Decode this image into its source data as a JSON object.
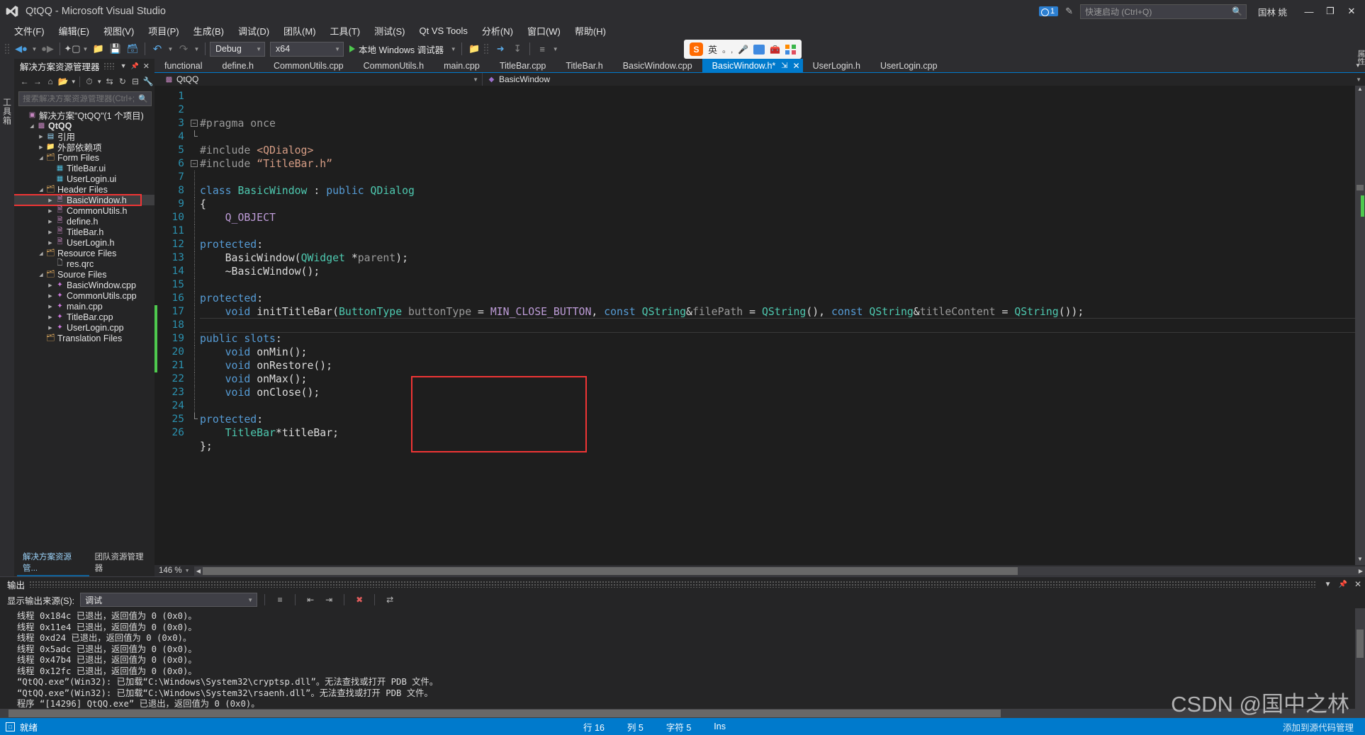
{
  "window": {
    "title": "QtQQ - Microsoft Visual Studio",
    "logo_icon": "visual-studio-logo",
    "minimize_label": "—",
    "maximize_label": "❐",
    "close_label": "✕",
    "notification_count": "1",
    "feedback_icon": "feedback-icon",
    "user_name": "国林 姚",
    "quick_launch_placeholder": "快速启动 (Ctrl+Q)",
    "quick_launch_value": "",
    "search_icon": "search-icon"
  },
  "menubar": {
    "items": [
      {
        "label": "文件(F)"
      },
      {
        "label": "编辑(E)"
      },
      {
        "label": "视图(V)"
      },
      {
        "label": "项目(P)"
      },
      {
        "label": "生成(B)"
      },
      {
        "label": "调试(D)"
      },
      {
        "label": "团队(M)"
      },
      {
        "label": "工具(T)"
      },
      {
        "label": "测试(S)"
      },
      {
        "label": "Qt VS Tools"
      },
      {
        "label": "分析(N)"
      },
      {
        "label": "窗口(W)"
      },
      {
        "label": "帮助(H)"
      }
    ]
  },
  "toolbar": {
    "back_icon": "navigate-back-icon",
    "forward_icon": "navigate-forward-icon",
    "new_project_icon": "new-project-icon",
    "open_file_icon": "open-file-icon",
    "save_icon": "save-icon",
    "save_all_icon": "save-all-icon",
    "undo_icon": "undo-icon",
    "redo_icon": "redo-icon",
    "config_value": "Debug",
    "platform_value": "x64",
    "run_label": "本地 Windows 调试器",
    "run_icon": "play-icon",
    "ime": {
      "logo_text": "S",
      "mode_label": "英",
      "punct_icon": "punctuation-icon",
      "mic_icon": "microphone-icon",
      "keyboard_icon": "keyboard-icon",
      "toolbox_icon": "toolbox-icon",
      "apps_icon": "apps-grid-icon"
    }
  },
  "left_rail": {
    "toolbox_label": "工具箱"
  },
  "right_rail": {
    "label": "属性"
  },
  "solution_explorer": {
    "title": "解决方案资源管理器",
    "dropdown_icon": "chevron-down-icon",
    "pin_icon": "pin-icon",
    "close_icon": "close-icon",
    "tools": [
      "back-icon",
      "forward-icon",
      "home-icon",
      "show-all-files-icon",
      "dropdown-icon",
      "pending-changes-icon",
      "sync-icon",
      "refresh-icon",
      "collapse-all-icon",
      "properties-icon"
    ],
    "search_placeholder": "搜索解决方案资源管理器(Ctrl+;",
    "search_value": "",
    "search_icon": "search-icon",
    "tree": [
      {
        "label": "解决方案\"QtQQ\"(1 个项目)",
        "indent": 0,
        "arrow": "",
        "icon": "solution-icon",
        "icon_class": "ic-sln",
        "bold": false,
        "selected": false,
        "highlight": false
      },
      {
        "label": "QtQQ",
        "indent": 1,
        "arrow": "expanded",
        "icon": "project-icon",
        "icon_class": "ic-proj",
        "bold": true,
        "selected": false,
        "highlight": false
      },
      {
        "label": "引用",
        "indent": 2,
        "arrow": "collapsed",
        "icon": "references-icon",
        "icon_class": "ic-ref",
        "bold": false,
        "selected": false,
        "highlight": false
      },
      {
        "label": "外部依赖项",
        "indent": 2,
        "arrow": "collapsed",
        "icon": "external-deps-icon",
        "icon_class": "ic-dep",
        "bold": false,
        "selected": false,
        "highlight": false
      },
      {
        "label": "Form Files",
        "indent": 2,
        "arrow": "expanded",
        "icon": "filter-folder-icon",
        "icon_class": "ic-folder",
        "bold": false,
        "selected": false,
        "highlight": false
      },
      {
        "label": "TitleBar.ui",
        "indent": 3,
        "arrow": "",
        "icon": "ui-file-icon",
        "icon_class": "ic-ui",
        "bold": false,
        "selected": false,
        "highlight": false
      },
      {
        "label": "UserLogin.ui",
        "indent": 3,
        "arrow": "",
        "icon": "ui-file-icon",
        "icon_class": "ic-ui",
        "bold": false,
        "selected": false,
        "highlight": false
      },
      {
        "label": "Header Files",
        "indent": 2,
        "arrow": "expanded",
        "icon": "filter-folder-icon",
        "icon_class": "ic-folder",
        "bold": false,
        "selected": false,
        "highlight": false
      },
      {
        "label": "BasicWindow.h",
        "indent": 3,
        "arrow": "collapsed",
        "icon": "header-file-icon",
        "icon_class": "ic-h",
        "bold": false,
        "selected": true,
        "highlight": true
      },
      {
        "label": "CommonUtils.h",
        "indent": 3,
        "arrow": "collapsed",
        "icon": "header-file-icon",
        "icon_class": "ic-h",
        "bold": false,
        "selected": false,
        "highlight": false
      },
      {
        "label": "define.h",
        "indent": 3,
        "arrow": "collapsed",
        "icon": "header-file-icon",
        "icon_class": "ic-h",
        "bold": false,
        "selected": false,
        "highlight": false
      },
      {
        "label": "TitleBar.h",
        "indent": 3,
        "arrow": "collapsed",
        "icon": "header-file-icon",
        "icon_class": "ic-h",
        "bold": false,
        "selected": false,
        "highlight": false
      },
      {
        "label": "UserLogin.h",
        "indent": 3,
        "arrow": "collapsed",
        "icon": "header-file-icon",
        "icon_class": "ic-h",
        "bold": false,
        "selected": false,
        "highlight": false
      },
      {
        "label": "Resource Files",
        "indent": 2,
        "arrow": "expanded",
        "icon": "filter-folder-icon",
        "icon_class": "ic-folder",
        "bold": false,
        "selected": false,
        "highlight": false
      },
      {
        "label": "res.qrc",
        "indent": 3,
        "arrow": "",
        "icon": "qrc-file-icon",
        "icon_class": "ic-file",
        "bold": false,
        "selected": false,
        "highlight": false
      },
      {
        "label": "Source Files",
        "indent": 2,
        "arrow": "expanded",
        "icon": "filter-folder-icon",
        "icon_class": "ic-folder",
        "bold": false,
        "selected": false,
        "highlight": false
      },
      {
        "label": "BasicWindow.cpp",
        "indent": 3,
        "arrow": "collapsed",
        "icon": "cpp-file-icon",
        "icon_class": "ic-cpp",
        "bold": false,
        "selected": false,
        "highlight": false
      },
      {
        "label": "CommonUtils.cpp",
        "indent": 3,
        "arrow": "collapsed",
        "icon": "cpp-file-icon",
        "icon_class": "ic-cpp",
        "bold": false,
        "selected": false,
        "highlight": false
      },
      {
        "label": "main.cpp",
        "indent": 3,
        "arrow": "collapsed",
        "icon": "cpp-file-icon",
        "icon_class": "ic-cpp",
        "bold": false,
        "selected": false,
        "highlight": false
      },
      {
        "label": "TitleBar.cpp",
        "indent": 3,
        "arrow": "collapsed",
        "icon": "cpp-file-icon",
        "icon_class": "ic-cpp",
        "bold": false,
        "selected": false,
        "highlight": false
      },
      {
        "label": "UserLogin.cpp",
        "indent": 3,
        "arrow": "collapsed",
        "icon": "cpp-file-icon",
        "icon_class": "ic-cpp",
        "bold": false,
        "selected": false,
        "highlight": false
      },
      {
        "label": "Translation Files",
        "indent": 2,
        "arrow": "",
        "icon": "filter-folder-icon",
        "icon_class": "ic-folder",
        "bold": false,
        "selected": false,
        "highlight": false
      }
    ],
    "bottom_tabs": [
      {
        "label": "解决方案资源管...",
        "active": true
      },
      {
        "label": "团队资源管理器",
        "active": false
      }
    ]
  },
  "editor": {
    "tabs": [
      {
        "label": "functional",
        "active": false
      },
      {
        "label": "define.h",
        "active": false
      },
      {
        "label": "CommonUtils.cpp",
        "active": false
      },
      {
        "label": "CommonUtils.h",
        "active": false
      },
      {
        "label": "main.cpp",
        "active": false
      },
      {
        "label": "TitleBar.cpp",
        "active": false
      },
      {
        "label": "TitleBar.h",
        "active": false
      },
      {
        "label": "BasicWindow.cpp",
        "active": false
      },
      {
        "label": "BasicWindow.h*",
        "active": true
      },
      {
        "label": "UserLogin.h",
        "active": false
      },
      {
        "label": "UserLogin.cpp",
        "active": false
      }
    ],
    "tab_pin_icon": "pin-icon",
    "tab_close_icon": "close-icon",
    "tab_overflow_icon": "chevron-down-icon",
    "navbar": {
      "project": "QtQQ",
      "project_icon": "project-icon",
      "symbol": "BasicWindow",
      "symbol_icon": "class-icon",
      "dropdown_icon": "chevron-down-icon"
    },
    "zoom": "146 %",
    "lines": [
      {
        "n": "1",
        "tokens": [
          {
            "t": "#pragma once",
            "c": "pp"
          }
        ]
      },
      {
        "n": "2",
        "tokens": []
      },
      {
        "n": "3",
        "tokens": [
          {
            "t": "#include ",
            "c": "pp"
          },
          {
            "t": "<QDialog>",
            "c": "str"
          }
        ],
        "fold": "start"
      },
      {
        "n": "4",
        "tokens": [
          {
            "t": "#include ",
            "c": "pp"
          },
          {
            "t": "“TitleBar.h”",
            "c": "str"
          }
        ],
        "fold": "end"
      },
      {
        "n": "5",
        "tokens": []
      },
      {
        "n": "6",
        "tokens": [
          {
            "t": "class ",
            "c": "kw"
          },
          {
            "t": "BasicWindow",
            "c": "typ"
          },
          {
            "t": " : ",
            "c": "pln"
          },
          {
            "t": "public ",
            "c": "kw"
          },
          {
            "t": "QDialog",
            "c": "typ"
          }
        ],
        "fold": "start"
      },
      {
        "n": "7",
        "tokens": [
          {
            "t": "{",
            "c": "pln"
          }
        ],
        "fold": "bar"
      },
      {
        "n": "8",
        "tokens": [
          {
            "t": "    ",
            "c": "pln"
          },
          {
            "t": "Q_OBJECT",
            "c": "mac"
          }
        ],
        "fold": "bar"
      },
      {
        "n": "9",
        "tokens": [],
        "fold": "bar"
      },
      {
        "n": "10",
        "tokens": [
          {
            "t": "protected",
            "c": "kw"
          },
          {
            "t": ":",
            "c": "pln"
          }
        ],
        "fold": "bar"
      },
      {
        "n": "11",
        "tokens": [
          {
            "t": "    ",
            "c": "pln"
          },
          {
            "t": "BasicWindow",
            "c": "pln"
          },
          {
            "t": "(",
            "c": "pln"
          },
          {
            "t": "QWidget",
            "c": "typ"
          },
          {
            "t": " *",
            "c": "pln"
          },
          {
            "t": "parent",
            "c": "par"
          },
          {
            "t": ");",
            "c": "pln"
          }
        ],
        "fold": "bar"
      },
      {
        "n": "12",
        "tokens": [
          {
            "t": "    ~BasicWindow();",
            "c": "pln"
          }
        ],
        "fold": "bar"
      },
      {
        "n": "13",
        "tokens": [],
        "fold": "bar"
      },
      {
        "n": "14",
        "tokens": [
          {
            "t": "protected",
            "c": "kw"
          },
          {
            "t": ":",
            "c": "pln"
          }
        ],
        "fold": "bar"
      },
      {
        "n": "15",
        "tokens": [
          {
            "t": "    ",
            "c": "pln"
          },
          {
            "t": "void ",
            "c": "kw"
          },
          {
            "t": "initTitleBar",
            "c": "pln"
          },
          {
            "t": "(",
            "c": "pln"
          },
          {
            "t": "ButtonType",
            "c": "typ"
          },
          {
            "t": " buttonType",
            "c": "par"
          },
          {
            "t": " = ",
            "c": "pln"
          },
          {
            "t": "MIN_CLOSE_BUTTON",
            "c": "mac"
          },
          {
            "t": ", ",
            "c": "pln"
          },
          {
            "t": "const ",
            "c": "kw"
          },
          {
            "t": "QString",
            "c": "typ"
          },
          {
            "t": "&",
            "c": "pln"
          },
          {
            "t": "filePath",
            "c": "par"
          },
          {
            "t": " = ",
            "c": "pln"
          },
          {
            "t": "QString",
            "c": "typ"
          },
          {
            "t": "(), ",
            "c": "pln"
          },
          {
            "t": "const ",
            "c": "kw"
          },
          {
            "t": "QString",
            "c": "typ"
          },
          {
            "t": "&",
            "c": "pln"
          },
          {
            "t": "titleContent",
            "c": "par"
          },
          {
            "t": " = ",
            "c": "pln"
          },
          {
            "t": "QString",
            "c": "typ"
          },
          {
            "t": "());",
            "c": "pln"
          }
        ],
        "fold": "bar"
      },
      {
        "n": "16",
        "tokens": [],
        "fold": "bar",
        "current": true
      },
      {
        "n": "17",
        "tokens": [
          {
            "t": "public slots",
            "c": "kw"
          },
          {
            "t": ":",
            "c": "pln"
          }
        ],
        "fold": "bar",
        "changed": true
      },
      {
        "n": "18",
        "tokens": [
          {
            "t": "    ",
            "c": "pln"
          },
          {
            "t": "void ",
            "c": "kw"
          },
          {
            "t": "onMin();",
            "c": "pln"
          }
        ],
        "fold": "bar",
        "changed": true
      },
      {
        "n": "19",
        "tokens": [
          {
            "t": "    ",
            "c": "pln"
          },
          {
            "t": "void ",
            "c": "kw"
          },
          {
            "t": "onRestore();",
            "c": "pln"
          }
        ],
        "fold": "bar",
        "changed": true
      },
      {
        "n": "20",
        "tokens": [
          {
            "t": "    ",
            "c": "pln"
          },
          {
            "t": "void ",
            "c": "kw"
          },
          {
            "t": "onMax();",
            "c": "pln"
          }
        ],
        "fold": "bar",
        "changed": true
      },
      {
        "n": "21",
        "tokens": [
          {
            "t": "    ",
            "c": "pln"
          },
          {
            "t": "void ",
            "c": "kw"
          },
          {
            "t": "onClose();",
            "c": "pln"
          }
        ],
        "fold": "bar",
        "changed": true
      },
      {
        "n": "22",
        "tokens": [],
        "fold": "bar"
      },
      {
        "n": "23",
        "tokens": [
          {
            "t": "protected",
            "c": "kw"
          },
          {
            "t": ":",
            "c": "pln"
          }
        ],
        "fold": "bar"
      },
      {
        "n": "24",
        "tokens": [
          {
            "t": "    ",
            "c": "pln"
          },
          {
            "t": "TitleBar",
            "c": "typ"
          },
          {
            "t": "*titleBar;",
            "c": "pln"
          }
        ],
        "fold": "bar"
      },
      {
        "n": "25",
        "tokens": [
          {
            "t": "};",
            "c": "pln"
          }
        ],
        "fold": "close"
      },
      {
        "n": "26",
        "tokens": []
      }
    ]
  },
  "output_panel": {
    "title": "输出",
    "pin_icon": "pin-icon",
    "close_icon": "close-icon",
    "dropdown_icon": "chevron-down-icon",
    "source_label": "显示输出来源(S):",
    "source_value": "调试",
    "buttons": [
      "find-message-icon",
      "go-to-previous-icon",
      "go-to-next-icon",
      "clear-all-icon",
      "toggle-word-wrap-icon"
    ],
    "lines": [
      "线程 0x184c 已退出，返回值为 0 (0x0)。",
      "线程 0x11e4 已退出，返回值为 0 (0x0)。",
      "线程 0xd24 已退出，返回值为 0 (0x0)。",
      "线程 0x5adc 已退出，返回值为 0 (0x0)。",
      "线程 0x47b4 已退出，返回值为 0 (0x0)。",
      "线程 0x12fc 已退出，返回值为 0 (0x0)。",
      "“QtQQ.exe”(Win32): 已加载“C:\\Windows\\System32\\cryptsp.dll”。无法查找或打开 PDB 文件。",
      "“QtQQ.exe”(Win32): 已加载“C:\\Windows\\System32\\rsaenh.dll”。无法查找或打开 PDB 文件。",
      "程序 “[14296] QtQQ.exe” 已退出，返回值为 0 (0x0)。"
    ]
  },
  "statusbar": {
    "status_icon": "ready-icon",
    "status_text": "就绪",
    "line_label": "行 16",
    "col_label": "列 5",
    "char_label": "字符 5",
    "insert_label": "Ins",
    "add_to_source_control": "添加到源代码管理"
  },
  "watermark": {
    "text": "CSDN @国中之林"
  },
  "colors": {
    "accent": "#007acc",
    "highlight_red": "#f03535",
    "title_bg": "#2d2d30",
    "editor_bg": "#1e1e1e",
    "panel_bg": "#252526"
  }
}
